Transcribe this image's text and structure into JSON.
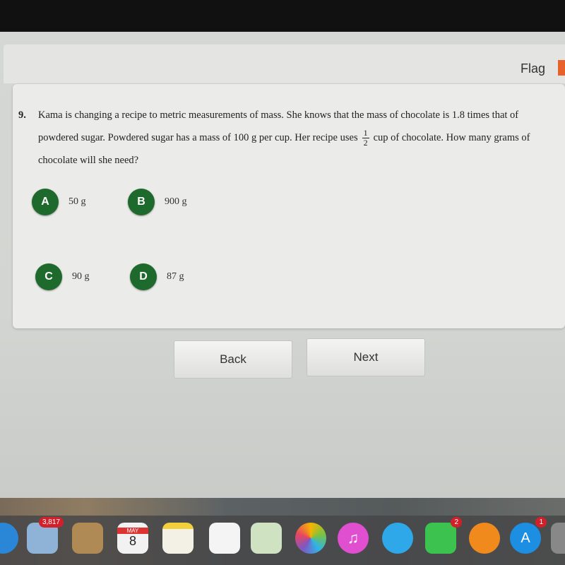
{
  "header": {
    "flag_label": "Flag"
  },
  "question": {
    "number": "9.",
    "text_part1": "Kama is changing a recipe to metric measurements of mass. She knows that the mass of chocolate is 1.8 times that of powdered sugar. Powdered sugar has a mass of 100 g per cup. Her recipe uses",
    "fraction_num": "1",
    "fraction_den": "2",
    "text_part2": "cup of chocolate. How many grams of chocolate will she need?"
  },
  "choices": [
    {
      "letter": "A",
      "text": "50 g"
    },
    {
      "letter": "B",
      "text": "900 g"
    },
    {
      "letter": "C",
      "text": "90 g"
    },
    {
      "letter": "D",
      "text": "87 g"
    }
  ],
  "nav": {
    "back_label": "Back",
    "next_label": "Next"
  },
  "dock": {
    "mail_badge": "3,817",
    "calendar_month": "MAY",
    "calendar_day": "8",
    "facetime_badge": "2",
    "appstore_badge": "1"
  },
  "colors": {
    "choice_badge": "#1e6a2c",
    "flag": "#e8602a"
  }
}
